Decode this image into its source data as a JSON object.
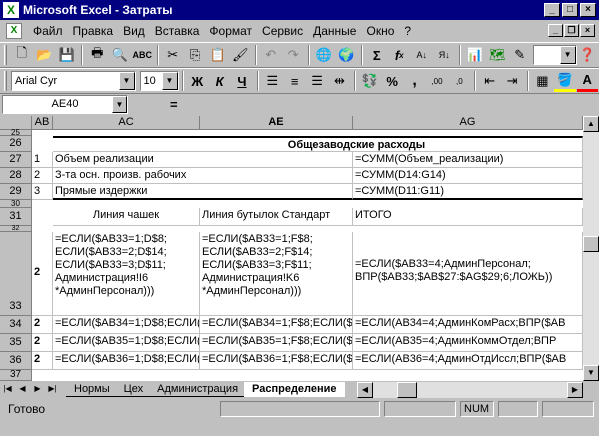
{
  "window": {
    "app_letter": "X",
    "title": "Microsoft Excel - Затраты"
  },
  "menu": [
    "Файл",
    "Правка",
    "Вид",
    "Вставка",
    "Формат",
    "Сервис",
    "Данные",
    "Окно",
    "?"
  ],
  "format_toolbar": {
    "font": "Arial Cyr",
    "size": "10",
    "bold": "Ж",
    "italic": "К",
    "underline": "Ч",
    "percent": "%",
    "comma": ",",
    "inc_dec": ",00",
    "dec_dec": ",0"
  },
  "std_toolbar": {
    "sum": "Σ",
    "fx": "f",
    "zoom": ""
  },
  "formula_bar": {
    "name_box": "AE40",
    "eq": "=",
    "content": ""
  },
  "columns": [
    "AB",
    "AC",
    "AE",
    "AG"
  ],
  "rows": {
    "r25": {
      "num": "25"
    },
    "r26": {
      "num": "26",
      "ac": "Общезаводские расходы"
    },
    "r27": {
      "num": "27",
      "ab": "1",
      "ac": "Объем реализации",
      "ag": "=СУММ(Объем_реализации)"
    },
    "r28": {
      "num": "28",
      "ab": "2",
      "ac": "З-та осн. произв. рабочих",
      "ag": "=СУММ(D14:G14)"
    },
    "r29": {
      "num": "29",
      "ab": "3",
      "ac": "Прямые издержки",
      "ag": "=СУММ(D11:G11)"
    },
    "r30": {
      "num": "30"
    },
    "r31": {
      "num": "31",
      "ac": "Линия чашек",
      "ae": "Линия бутылок Стандарт",
      "ag": "ИТОГО"
    },
    "r32": {
      "num": "32"
    },
    "r33": {
      "num": "33",
      "ab": "2",
      "ac": [
        "=ЕСЛИ($AB33=1;D$8;",
        "ЕСЛИ($AB33=2;D$14;",
        "ЕСЛИ($AB33=3;D$11;",
        "Администрация!I6",
        "*АдминПерсонал)))"
      ],
      "ae": [
        "=ЕСЛИ($AB33=1;F$8;",
        "ЕСЛИ($AB33=2;F$14;",
        "ЕСЛИ($AB33=3;F$11;",
        "Администрация!K6",
        "*АдминПерсонал)))"
      ],
      "ag": [
        "=ЕСЛИ($AB33=4;АдминПерсонал;",
        "ВПР($AB33;$AB$27:$AG$29;6;ЛОЖЬ))"
      ]
    },
    "r34": {
      "num": "34",
      "ab": "2",
      "ac": "=ЕСЛИ($AB34=1;D$8;ЕСЛИ($AB34",
      "ae": "=ЕСЛИ($AB34=1;F$8;ЕСЛИ($AB34",
      "ag": "=ЕСЛИ(AB34=4;АдминКомРасх;ВПР($AB"
    },
    "r35": {
      "num": "35",
      "ab": "2",
      "ac": "=ЕСЛИ($AB35=1;D$8;ЕСЛИ($AB35",
      "ae": "=ЕСЛИ($AB35=1;F$8;ЕСЛИ($AB35",
      "ag": "=ЕСЛИ(AB35=4;АдминКоммОтдел;ВПР"
    },
    "r36": {
      "num": "36",
      "ab": "2",
      "ac": "=ЕСЛИ($AB36=1;D$8;ЕСЛИ($AB36",
      "ae": "=ЕСЛИ($AB36=1;F$8;ЕСЛИ($AB36",
      "ag": "=ЕСЛИ(AB36=4;АдминОтдИссл;ВПР($AB"
    },
    "r37": {
      "num": "37"
    }
  },
  "sheet_tabs": [
    "Нормы",
    "Цех",
    "Администрация",
    "Распределение"
  ],
  "active_tab": "Распределение",
  "status": {
    "text": "Готово",
    "num": "NUM"
  }
}
